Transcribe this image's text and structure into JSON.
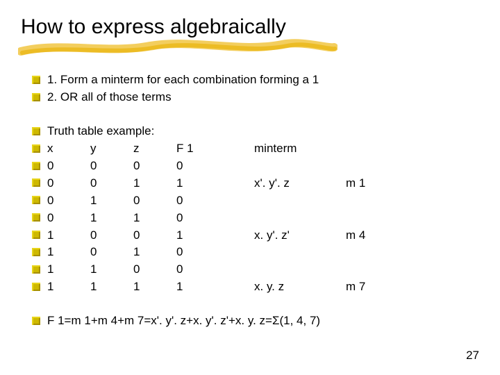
{
  "slide": {
    "title": "How to express algebraically",
    "pagenum": "27"
  },
  "intro": {
    "item1": "1. Form a minterm for each combination forming a 1",
    "item2": "2. OR all of those terms"
  },
  "truth": {
    "header": "Truth table example:",
    "cols": {
      "x": "x",
      "y": "y",
      "z": "z",
      "f1": "F 1",
      "minterm": "minterm"
    },
    "rows": [
      {
        "x": "0",
        "y": "0",
        "z": "0",
        "f1": "0",
        "mt": "",
        "mi": ""
      },
      {
        "x": "0",
        "y": "0",
        "z": "1",
        "f1": "1",
        "mt": "x'. y'. z",
        "mi": "m 1"
      },
      {
        "x": "0",
        "y": "1",
        "z": "0",
        "f1": "0",
        "mt": "",
        "mi": ""
      },
      {
        "x": "0",
        "y": "1",
        "z": "1",
        "f1": "0",
        "mt": "",
        "mi": ""
      },
      {
        "x": "1",
        "y": "0",
        "z": "0",
        "f1": "1",
        "mt": "x. y'. z'",
        "mi": "m 4"
      },
      {
        "x": "1",
        "y": "0",
        "z": "1",
        "f1": "0",
        "mt": "",
        "mi": ""
      },
      {
        "x": "1",
        "y": "1",
        "z": "0",
        "f1": "0",
        "mt": "",
        "mi": ""
      },
      {
        "x": "1",
        "y": "1",
        "z": "1",
        "f1": "1",
        "mt": "x. y. z",
        "mi": "m 7"
      }
    ]
  },
  "result": {
    "line": "F 1=m 1+m 4+m 7=x'. y'. z+x. y'. z'+x. y. z=Σ(1, 4, 7)"
  }
}
